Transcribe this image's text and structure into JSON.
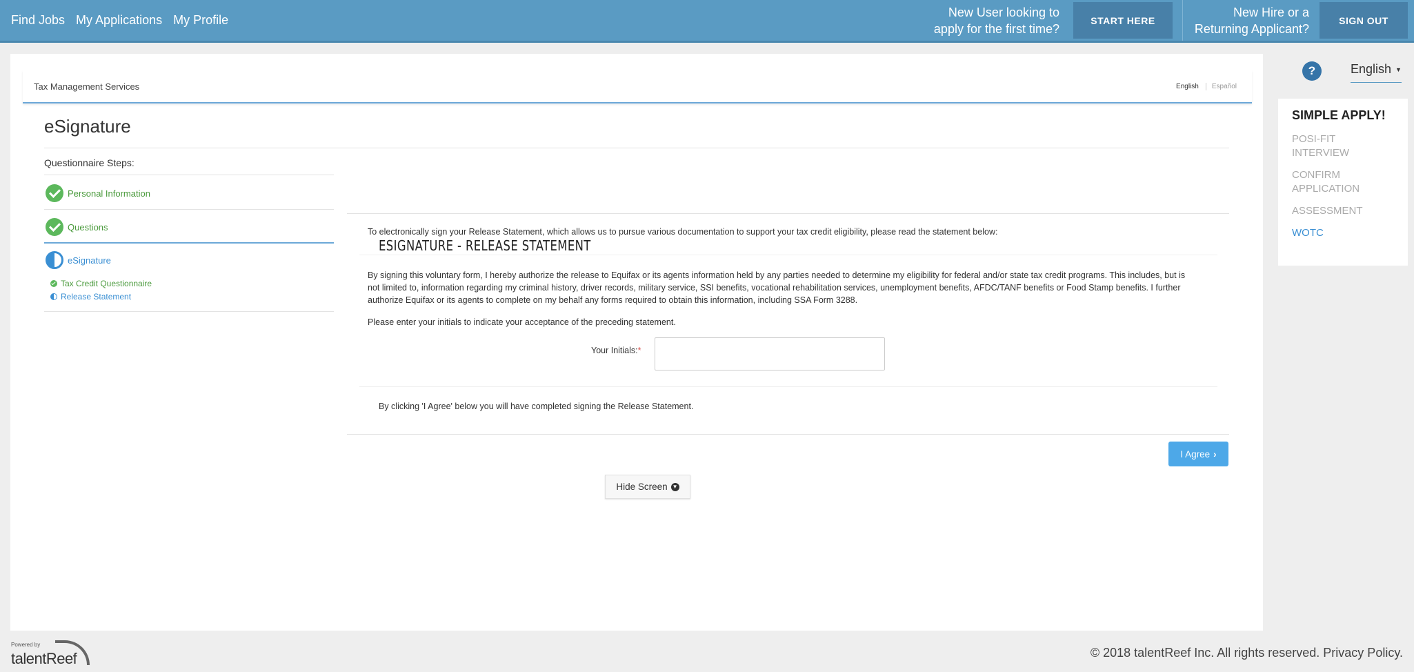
{
  "topbar": {
    "nav": [
      "Find Jobs",
      "My Applications",
      "My Profile"
    ],
    "new_user_line1": "New User looking to",
    "new_user_line2": "apply for the first time?",
    "start_here": "START HERE",
    "returning_line1": "New Hire or a",
    "returning_line2": "Returning Applicant?",
    "sign_out": "SIGN OUT"
  },
  "card": {
    "company": "Tax Management Services",
    "lang_english": "English",
    "lang_espanol": "Español",
    "page_title": "eSignature"
  },
  "steps": {
    "label": "Questionnaire Steps:",
    "items": [
      {
        "label": "Personal Information",
        "status": "complete"
      },
      {
        "label": "Questions",
        "status": "complete"
      },
      {
        "label": "eSignature",
        "status": "in-progress"
      }
    ],
    "sub_items": [
      {
        "label": "Tax Credit Questionnaire",
        "status": "complete"
      },
      {
        "label": "Release Statement",
        "status": "in-progress"
      }
    ]
  },
  "content": {
    "section_title": "ESIGNATURE - RELEASE STATEMENT",
    "intro": "To electronically sign your Release Statement, which allows us to pursue various documentation to support your tax credit eligibility, please read the statement below:",
    "statement": "By signing this voluntary form, I hereby authorize the release to Equifax or its agents information held by any parties needed to determine my eligibility for federal and/or state tax credit programs. This includes, but is not limited to, information regarding my criminal history, driver records, military service, SSI benefits, vocational rehabilitation services, unemployment benefits, AFDC/TANF benefits or Food Stamp benefits. I further authorize Equifax or its agents to complete on my behalf any forms required to obtain this information, including SSA Form 3288.",
    "prompt": "Please enter your initials to indicate your acceptance of the preceding statement.",
    "initials_label": "Your Initials:",
    "initials_required": "*",
    "initials_value": "",
    "agree_note": "By clicking 'I Agree' below you will have completed signing the Release Statement.",
    "agree_button": "I Agree",
    "hide_button": "Hide Screen"
  },
  "sidebar": {
    "help": "?",
    "language": "English",
    "apply_title": "SIMPLE APPLY!",
    "apply_steps": [
      {
        "label": "POSI-FIT INTERVIEW",
        "active": false
      },
      {
        "label": "CONFIRM APPLICATION",
        "active": false
      },
      {
        "label": "ASSESSMENT",
        "active": false
      },
      {
        "label": "WOTC",
        "active": true
      }
    ]
  },
  "footer": {
    "powered_by": "Powered by",
    "brand": "talentReef",
    "copyright": "© 2018 talentReef Inc. All rights reserved. Privacy Policy."
  },
  "colors": {
    "topbar": "#5a9bc3",
    "complete": "#5cb85c",
    "in_progress": "#3a8fd3",
    "agree_button": "#4da8e8"
  }
}
